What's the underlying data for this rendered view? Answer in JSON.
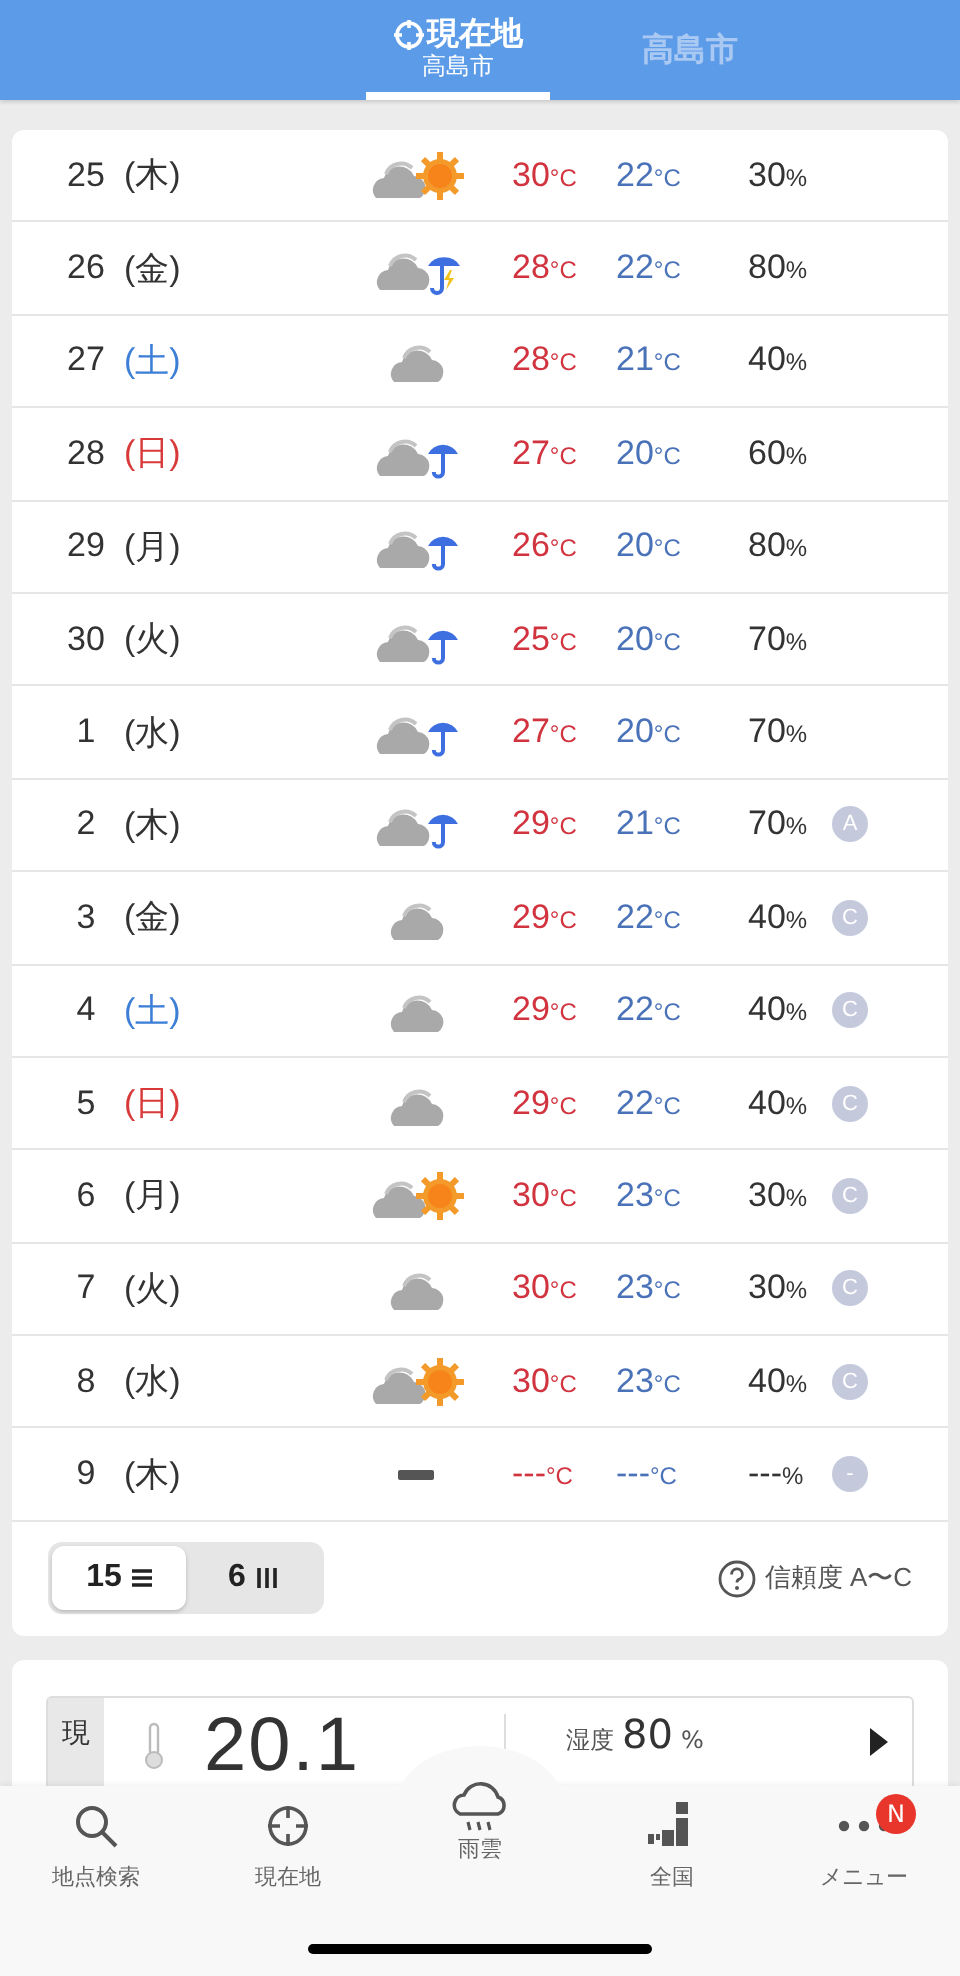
{
  "header": {
    "tabs": [
      {
        "label": "現在地",
        "sub": "高島市",
        "kind": "location",
        "selected": true
      },
      {
        "label": "高島市",
        "kind": "place",
        "selected": false
      }
    ]
  },
  "forecast": {
    "rows": [
      {
        "day": "25",
        "weekday": {
          "text": "(木)",
          "kind": "weekday"
        },
        "weather": {
          "kind": "cloud_sun"
        },
        "high": "30",
        "high_unit": "°C",
        "low": "22",
        "low_unit": "°C",
        "pop": "30",
        "pop_unit": "%"
      },
      {
        "day": "26",
        "weekday": {
          "text": "(金)",
          "kind": "weekday"
        },
        "weather": {
          "kind": "cloud_umbrella_thunder"
        },
        "high": "28",
        "high_unit": "°C",
        "low": "22",
        "low_unit": "°C",
        "pop": "80",
        "pop_unit": "%"
      },
      {
        "day": "27",
        "weekday": {
          "text": "(土)",
          "kind": "saturday"
        },
        "weather": {
          "kind": "cloud"
        },
        "high": "28",
        "high_unit": "°C",
        "low": "21",
        "low_unit": "°C",
        "pop": "40",
        "pop_unit": "%"
      },
      {
        "day": "28",
        "weekday": {
          "text": "(日)",
          "kind": "sunday"
        },
        "weather": {
          "kind": "cloud_umbrella"
        },
        "high": "27",
        "high_unit": "°C",
        "low": "20",
        "low_unit": "°C",
        "pop": "60",
        "pop_unit": "%"
      },
      {
        "day": "29",
        "weekday": {
          "text": "(月)",
          "kind": "weekday"
        },
        "weather": {
          "kind": "cloud_umbrella"
        },
        "high": "26",
        "high_unit": "°C",
        "low": "20",
        "low_unit": "°C",
        "pop": "80",
        "pop_unit": "%"
      },
      {
        "day": "30",
        "weekday": {
          "text": "(火)",
          "kind": "weekday"
        },
        "weather": {
          "kind": "cloud_umbrella"
        },
        "high": "25",
        "high_unit": "°C",
        "low": "20",
        "low_unit": "°C",
        "pop": "70",
        "pop_unit": "%"
      },
      {
        "day": "1",
        "weekday": {
          "text": "(水)",
          "kind": "weekday"
        },
        "weather": {
          "kind": "cloud_umbrella"
        },
        "high": "27",
        "high_unit": "°C",
        "low": "20",
        "low_unit": "°C",
        "pop": "70",
        "pop_unit": "%"
      },
      {
        "day": "2",
        "weekday": {
          "text": "(木)",
          "kind": "weekday"
        },
        "weather": {
          "kind": "cloud_umbrella"
        },
        "high": "29",
        "high_unit": "°C",
        "low": "21",
        "low_unit": "°C",
        "pop": "70",
        "pop_unit": "%",
        "reliability": "A"
      },
      {
        "day": "3",
        "weekday": {
          "text": "(金)",
          "kind": "weekday"
        },
        "weather": {
          "kind": "cloud"
        },
        "high": "29",
        "high_unit": "°C",
        "low": "22",
        "low_unit": "°C",
        "pop": "40",
        "pop_unit": "%",
        "reliability": "C"
      },
      {
        "day": "4",
        "weekday": {
          "text": "(土)",
          "kind": "saturday"
        },
        "weather": {
          "kind": "cloud"
        },
        "high": "29",
        "high_unit": "°C",
        "low": "22",
        "low_unit": "°C",
        "pop": "40",
        "pop_unit": "%",
        "reliability": "C"
      },
      {
        "day": "5",
        "weekday": {
          "text": "(日)",
          "kind": "sunday"
        },
        "weather": {
          "kind": "cloud"
        },
        "high": "29",
        "high_unit": "°C",
        "low": "22",
        "low_unit": "°C",
        "pop": "40",
        "pop_unit": "%",
        "reliability": "C"
      },
      {
        "day": "6",
        "weekday": {
          "text": "(月)",
          "kind": "weekday"
        },
        "weather": {
          "kind": "cloud_sun"
        },
        "high": "30",
        "high_unit": "°C",
        "low": "23",
        "low_unit": "°C",
        "pop": "30",
        "pop_unit": "%",
        "reliability": "C"
      },
      {
        "day": "7",
        "weekday": {
          "text": "(火)",
          "kind": "weekday"
        },
        "weather": {
          "kind": "cloud"
        },
        "high": "30",
        "high_unit": "°C",
        "low": "23",
        "low_unit": "°C",
        "pop": "30",
        "pop_unit": "%",
        "reliability": "C"
      },
      {
        "day": "8",
        "weekday": {
          "text": "(水)",
          "kind": "weekday"
        },
        "weather": {
          "kind": "cloud_sun"
        },
        "high": "30",
        "high_unit": "°C",
        "low": "23",
        "low_unit": "°C",
        "pop": "40",
        "pop_unit": "%",
        "reliability": "C"
      },
      {
        "day": "9",
        "weekday": {
          "text": "(木)",
          "kind": "weekday"
        },
        "weather": {
          "kind": "none"
        },
        "high": "---",
        "high_unit": "°C",
        "low": "---",
        "low_unit": "°C",
        "pop": "---",
        "pop_unit": "%",
        "reliability": "-"
      }
    ],
    "toggle": [
      {
        "label": "15",
        "kind": "list",
        "selected": true
      },
      {
        "label": "6",
        "kind": "bars",
        "selected": false
      }
    ],
    "help": "信頼度 A〜C"
  },
  "current": {
    "label": "現",
    "temp": "20.1",
    "humidity_label": "湿度",
    "humidity": "80",
    "humidity_unit": "%"
  },
  "nav": [
    {
      "label": "地点検索",
      "kind": "search"
    },
    {
      "label": "現在地",
      "kind": "location"
    },
    {
      "label": "雨雲",
      "kind": "rain"
    },
    {
      "label": "全国",
      "kind": "map"
    },
    {
      "label": "メニュー",
      "kind": "menu",
      "badge": "N"
    }
  ]
}
